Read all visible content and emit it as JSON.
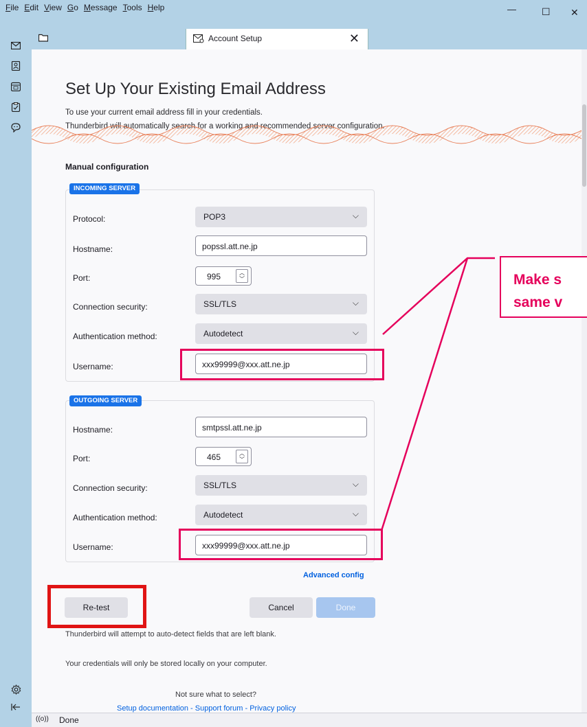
{
  "menubar": {
    "items": [
      "File",
      "Edit",
      "View",
      "Go",
      "Message",
      "Tools",
      "Help"
    ],
    "minimize": "—",
    "maximize": "☐",
    "close": "✕"
  },
  "spaces_toolbar": {
    "icons": [
      "mail-icon",
      "address-book-icon",
      "calendar-icon",
      "tasks-icon",
      "chat-icon",
      "settings-icon",
      "collapse-icon"
    ]
  },
  "tab": {
    "title": "Account Setup",
    "close": "✕"
  },
  "page": {
    "title": "Set Up Your Existing Email Address",
    "subtitle_line1": "To use your current email address fill in your credentials.",
    "subtitle_line2": "Thunderbird will automatically search for a working and recommended server configuration.",
    "manual_heading": "Manual configuration"
  },
  "incoming": {
    "legend": "INCOMING SERVER",
    "protocol_label": "Protocol:",
    "protocol_value": "POP3",
    "hostname_label": "Hostname:",
    "hostname_value": "popssl.att.ne.jp",
    "port_label": "Port:",
    "port_value": "995",
    "security_label": "Connection security:",
    "security_value": "SSL/TLS",
    "auth_label": "Authentication method:",
    "auth_value": "Autodetect",
    "username_label": "Username:",
    "username_value": "xxx99999@xxx.att.ne.jp"
  },
  "outgoing": {
    "legend": "OUTGOING SERVER",
    "hostname_label": "Hostname:",
    "hostname_value": "smtpssl.att.ne.jp",
    "port_label": "Port:",
    "port_value": "465",
    "security_label": "Connection security:",
    "security_value": "SSL/TLS",
    "auth_label": "Authentication method:",
    "auth_value": "Autodetect",
    "username_label": "Username:",
    "username_value": "xxx99999@xxx.att.ne.jp"
  },
  "actions": {
    "advanced_config": "Advanced config",
    "retest": "Re-test",
    "cancel": "Cancel",
    "done": "Done"
  },
  "info": {
    "autodetect": "Thunderbird will attempt to auto-detect fields that are left blank.",
    "credentials": "Your credentials will only be stored locally on your computer.",
    "not_sure": "Not sure what to select?",
    "links": "Setup documentation - Support forum - Privacy policy"
  },
  "status": {
    "signal": "((o))",
    "text": "Done"
  },
  "annotation": {
    "callout_text": "Make s\nsame v"
  },
  "colors": {
    "accent": "#1a73e8",
    "highlight": "#e5005b",
    "retest_highlight": "#e01414",
    "chrome": "#b3d2e6"
  }
}
